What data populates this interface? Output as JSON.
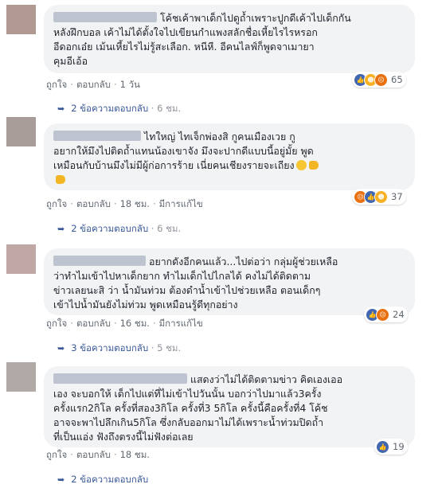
{
  "colors": {
    "link": "#385898",
    "meta": "#606770",
    "bubble_bg": "#f2f3f5",
    "like": "#4267b2",
    "haha": "#f7b125",
    "angry": "#e9710f",
    "love": "#f25268"
  },
  "comments": [
    {
      "avatar_color": "#b09990",
      "lines": [
        "โค้ชเค้าพาเด็กไปดูถ้ำเพราะปูกดีเค้าไปเด็กกัน",
        "หลังฝึกบอล เค้าไม่ได้ตั้งใจไปเขียนกำแพงสลักชื่อเหี้ยไรไรหรอก",
        "อีดอกเอ๋ย เม้นเหี้ยไรไม่รู้สะเลือก. หนีหี. อีคนไลฟ์ก็พูดจาเมายา",
        "คุมอีเอ้อ"
      ],
      "actions": [
        "ถูกใจ",
        "ตอบกลับ",
        "1 วัน"
      ],
      "reaction_icons": [
        "like-icon",
        "haha-icon",
        "angry-icon"
      ],
      "reaction_count": "65",
      "replies_label": "2 ข้อความตอบกลับ",
      "replies_time": "6 ชม."
    },
    {
      "avatar_color": "#a89c98",
      "lines": [
        "ไทใหญ่ ไทเจ็กพ่องสิ กูคนเมืองเวย กู",
        "อยากให้มึงไปติดถ้ำแทนน้องเขาจัง มึงจะปากดีแบบนี้อยู่มั้ย พูด",
        "เหมือนกับบ้านมึงไม่มีผู้ก่อการร้าย เนี่ยคนเชียงรายจะเถียง",
        ""
      ],
      "actions": [
        "ถูกใจ",
        "ตอบกลับ",
        "18 ชม.",
        "มีการแก้ไข"
      ],
      "reaction_icons": [
        "angry-icon",
        "like-icon",
        "haha-icon"
      ],
      "reaction_count": "37",
      "replies_label": "2 ข้อความตอบกลับ",
      "replies_time": "6 ชม."
    },
    {
      "avatar_color": "#c0a8a6",
      "lines": [
        "อยากดังอีกคนแล้ว...ไปต่อว่า กลุ่มผู้ช่วยเหลือ",
        "ว่าทำไมเข้าไปหาเด็กยาก ทำไมเด็กไปไกลได้ คงไม่ได้ติดตาม",
        "ข่าวเลยนะสิ ว่า น้ำมันท่วม ต้องดำน้ำเข้าไปช่วยเหลือ ตอนเด็กๆ",
        "เข้าไปน้ำมันยังไม่ท่วม พูดเหมือนรู้ดีทุกอย่าง"
      ],
      "actions": [
        "ถูกใจ",
        "ตอบกลับ",
        "16 ชม.",
        "มีการแก้ไข"
      ],
      "reaction_icons": [
        "like-icon",
        "angry-icon"
      ],
      "reaction_count": "24",
      "replies_label": "3 ข้อความตอบกลับ",
      "replies_time": "5 ชม."
    },
    {
      "avatar_color": "#b0a9a6",
      "lines": [
        "แสดงว่าไม่ได้ติดตามข่าว คิดเองเออ",
        "เอง จะบอกให้ เด็กไปแต่ที่ไม่เข้าไปวันนั้น บอกว่าไปมาแล้ว3ครั้ง",
        "ครั้งแรก2กิโล ครั้งที่สอง3กิโล ครั้งที่3 5กิโล ครั้งนี้คือครั้งที่4 โค้ช",
        "อาจจะพาไปลึกเกิน5กิโล ซึ่งกลับออกมาไม่ได้เพราะน้ำท่วมปิดถ้ำ",
        "ที่เป็นแอ่ง ฟังถึงตรงนี้ไม่ฟังต่อเลย"
      ],
      "actions": [
        "ถูกใจ",
        "ตอบกลับ",
        "18 ชม."
      ],
      "reaction_icons": [
        "like-icon"
      ],
      "reaction_count": "19",
      "replies_label": "2 ข้อความตอบกลับ",
      "replies_time": ""
    }
  ]
}
